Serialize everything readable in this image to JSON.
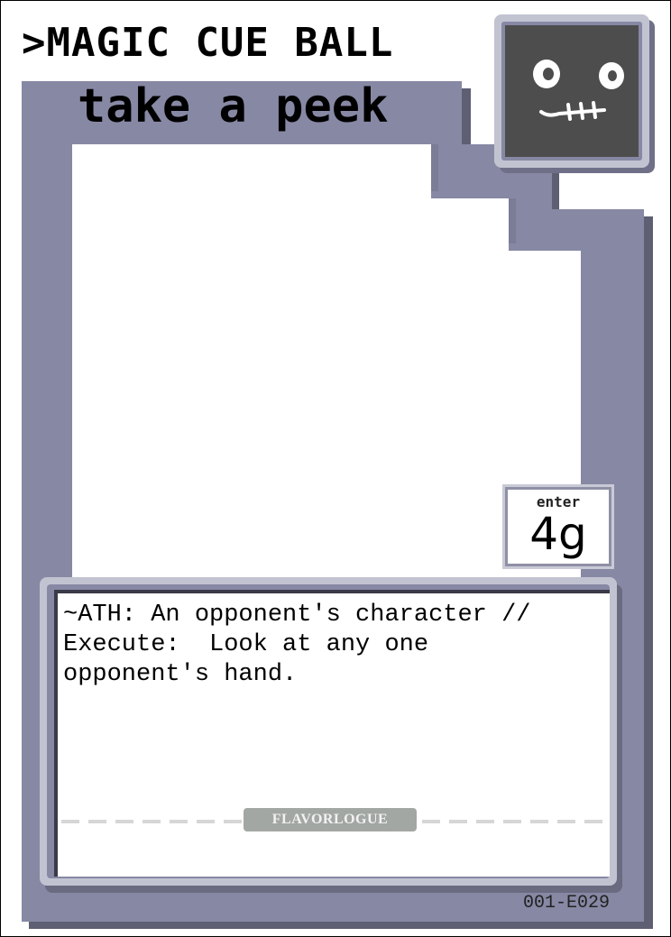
{
  "card": {
    "prompt_symbol": ">",
    "title": "MAGIC CUE BALL",
    "subtitle": "take a peek",
    "cost": {
      "label": "enter",
      "value": "4g"
    },
    "rules_text": "~ATH: An opponent's character //\nExecute:  Look at any one\nopponent's hand.",
    "flavor_label": "FLAVORLOGUE",
    "card_code": "001-E029",
    "portrait_icon": "stitched-smile-face-icon"
  },
  "colors": {
    "frame": "#8788a4",
    "frame_shadow": "#5e5f72",
    "frame_light": "#c9cad6",
    "panel_border": "#b9bac8",
    "portrait_bg": "#4d4d4d",
    "flavor_tag": "#a3a7a3"
  }
}
